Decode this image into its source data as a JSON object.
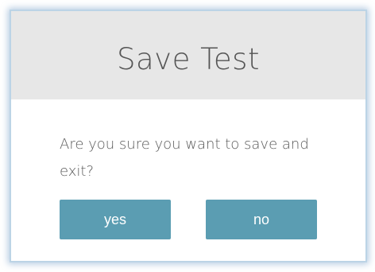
{
  "dialog": {
    "title": "Save Test",
    "message": "Are you sure you want to save and exit?",
    "yes_label": "yes",
    "no_label": "no"
  },
  "colors": {
    "header_background": "#e7e7e7",
    "button_background": "#5b9db2",
    "title_text": "#555555",
    "message_text": "#5a5a5a",
    "frame_glow": "#bcd4e6"
  }
}
